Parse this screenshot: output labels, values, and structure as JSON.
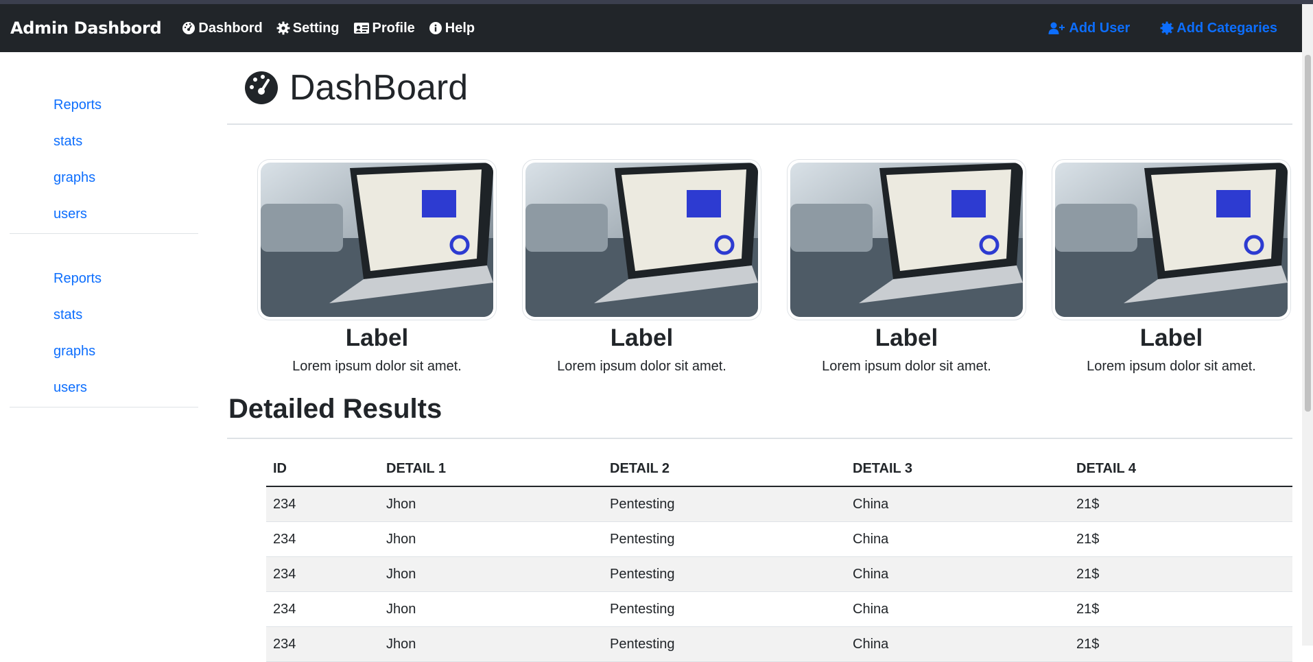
{
  "navbar": {
    "brand": "Admin Dashbord",
    "links": [
      {
        "label": "Dashbord",
        "icon": "dashboard-gauge-icon"
      },
      {
        "label": "Setting",
        "icon": "gear-icon"
      },
      {
        "label": "Profile",
        "icon": "id-card-icon"
      },
      {
        "label": "Help",
        "icon": "info-circle-icon"
      }
    ],
    "right_links": [
      {
        "label": "Add User",
        "icon": "user-plus-icon"
      },
      {
        "label": "Add Categaries",
        "icon": "gear-badge-icon"
      }
    ]
  },
  "sidebar": {
    "groups": [
      {
        "items": [
          "Reports",
          "stats",
          "graphs",
          "users"
        ]
      },
      {
        "items": [
          "Reports",
          "stats",
          "graphs",
          "users"
        ]
      }
    ]
  },
  "main": {
    "title": "DashBoard",
    "cards": [
      {
        "label": "Label",
        "text": "Lorem ipsum dolor sit amet."
      },
      {
        "label": "Label",
        "text": "Lorem ipsum dolor sit amet."
      },
      {
        "label": "Label",
        "text": "Lorem ipsum dolor sit amet."
      },
      {
        "label": "Label",
        "text": "Lorem ipsum dolor sit amet."
      }
    ],
    "results_title": "Detailed Results",
    "table": {
      "headers": [
        "ID",
        "DETAIL 1",
        "DETAIL 2",
        "DETAIL 3",
        "DETAIL 4"
      ],
      "rows": [
        [
          "234",
          "Jhon",
          "Pentesting",
          "China",
          "21$"
        ],
        [
          "234",
          "Jhon",
          "Pentesting",
          "China",
          "21$"
        ],
        [
          "234",
          "Jhon",
          "Pentesting",
          "China",
          "21$"
        ],
        [
          "234",
          "Jhon",
          "Pentesting",
          "China",
          "21$"
        ],
        [
          "234",
          "Jhon",
          "Pentesting",
          "China",
          "21$"
        ]
      ]
    }
  },
  "colors": {
    "navbar_bg": "#212529",
    "link": "#0d6efd",
    "text": "#212529"
  }
}
